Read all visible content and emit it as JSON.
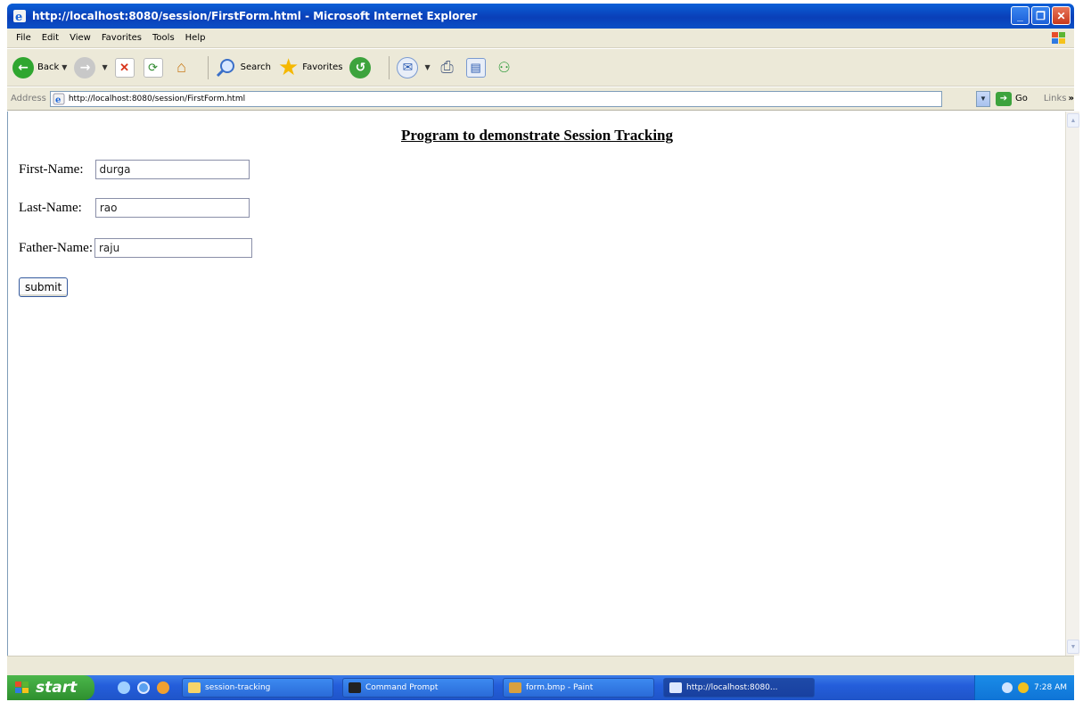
{
  "window": {
    "title": "http://localhost:8080/session/FirstForm.html - Microsoft Internet Explorer",
    "minimize": "_",
    "maximize": "❐",
    "close": "✕"
  },
  "menu": [
    "File",
    "Edit",
    "View",
    "Favorites",
    "Tools",
    "Help"
  ],
  "toolbar": {
    "back_label": "Back",
    "search_label": "Search",
    "favorites_label": "Favorites"
  },
  "address": {
    "label": "Address",
    "url": "http://localhost:8080/session/FirstForm.html",
    "go_label": "Go",
    "links_label": "Links",
    "links_chevron": "»"
  },
  "page": {
    "heading": "Program to demonstrate Session Tracking",
    "first_name_label": "First-Name:",
    "first_name_value": "durga",
    "last_name_label": "Last-Name:",
    "last_name_value": "rao",
    "father_name_label": "Father-Name:",
    "father_name_value": "raju",
    "submit_label": "submit"
  },
  "taskbar": {
    "start_label": "start",
    "tasks": [
      "session-tracking",
      "Command Prompt",
      "form.bmp - Paint",
      "http://localhost:8080..."
    ],
    "clock": "7:28 AM"
  },
  "colors": {
    "titlebar": "#0a4fc8",
    "chrome": "#ece9d8",
    "taskbar": "#245edb",
    "start": "#3ca33c"
  }
}
